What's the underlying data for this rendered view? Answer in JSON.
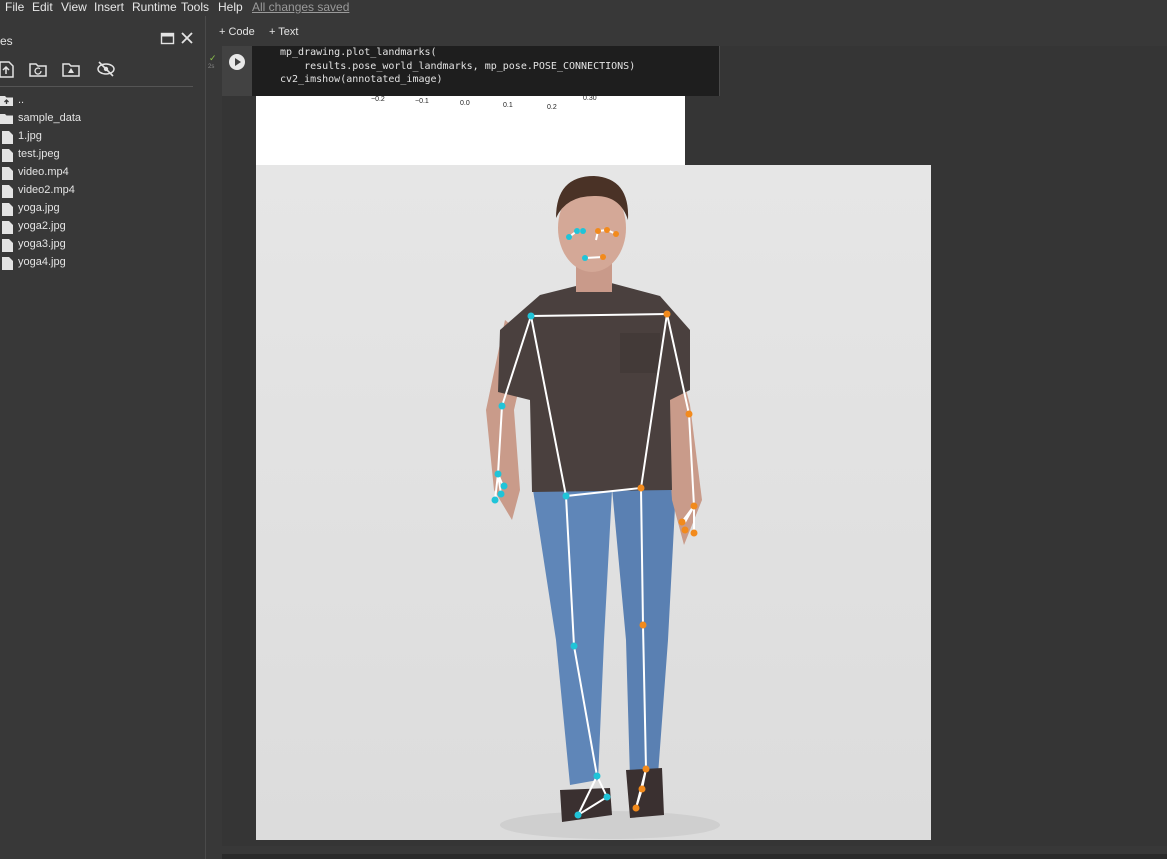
{
  "menu": {
    "items": [
      "File",
      "Edit",
      "View",
      "Insert",
      "Runtime",
      "Tools",
      "Help"
    ],
    "save_status": "All changes saved"
  },
  "sidebar": {
    "title": "es",
    "parent_dir": "..",
    "files": [
      {
        "name": "sample_data",
        "type": "folder"
      },
      {
        "name": "1.jpg",
        "type": "file"
      },
      {
        "name": "test.jpeg",
        "type": "file"
      },
      {
        "name": "video.mp4",
        "type": "file"
      },
      {
        "name": "video2.mp4",
        "type": "file"
      },
      {
        "name": "yoga.jpg",
        "type": "file"
      },
      {
        "name": "yoga2.jpg",
        "type": "file"
      },
      {
        "name": "yoga3.jpg",
        "type": "file"
      },
      {
        "name": "yoga4.jpg",
        "type": "file"
      }
    ],
    "tools": [
      "upload-icon",
      "refresh-folder-icon",
      "drive-icon",
      "hide-icon"
    ]
  },
  "toolbar": {
    "add_code": "+ Code",
    "add_text": "+ Text"
  },
  "cell": {
    "code_lines": [
      "mp_drawing.plot_landmarks(",
      "    results.pose_world_landmarks, mp_pose.POSE_CONNECTIONS)",
      "cv2_imshow(annotated_image)"
    ],
    "exec_time": "2s",
    "plot_ticks": [
      "−0.2",
      "−0.1",
      "0.0",
      "0.1",
      "0.2",
      "0.30"
    ]
  },
  "colors": {
    "left_landmark": "#20c4d8",
    "right_landmark": "#f28a1c",
    "connection": "#ffffff",
    "background": "#383838"
  }
}
